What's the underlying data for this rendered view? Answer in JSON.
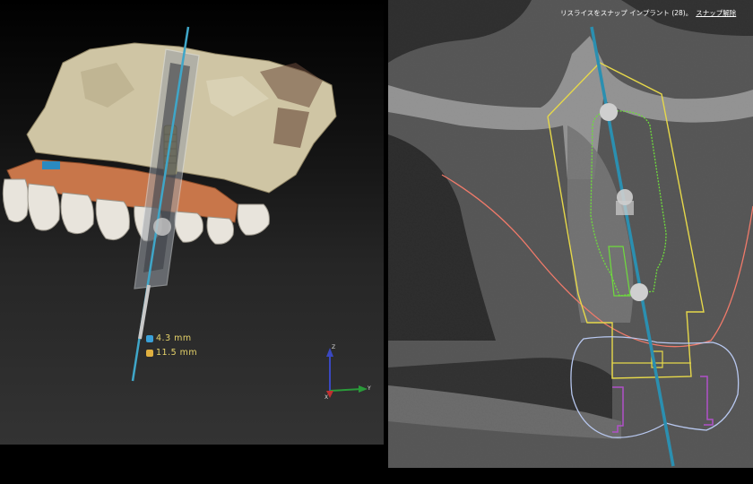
{
  "view3d": {
    "measurements": [
      {
        "badge": "diameter-badge",
        "color": "#3aa0d8",
        "text": "4.3  mm"
      },
      {
        "badge": "length-badge",
        "color": "#e0b040",
        "text": "11.5  mm"
      }
    ],
    "axes": {
      "z": "Z",
      "y": "Y",
      "x": "X"
    },
    "colors": {
      "implant_axis": "#3fa6c8",
      "gum": "#c8764a",
      "bone": "#d8cfb0"
    }
  },
  "slice_view": {
    "snap_label": "リスライスをスナップ インプラント (28)。",
    "snap_undo": "スナップ解除",
    "colors": {
      "implant_axis": "#2b8fb0",
      "safety_zone": "#e6d84a",
      "implant_outline": "#6edc3c",
      "nerve": "#f07a6a",
      "crown": "#b8c8f0",
      "abutment_marks": "#b050c8"
    }
  }
}
